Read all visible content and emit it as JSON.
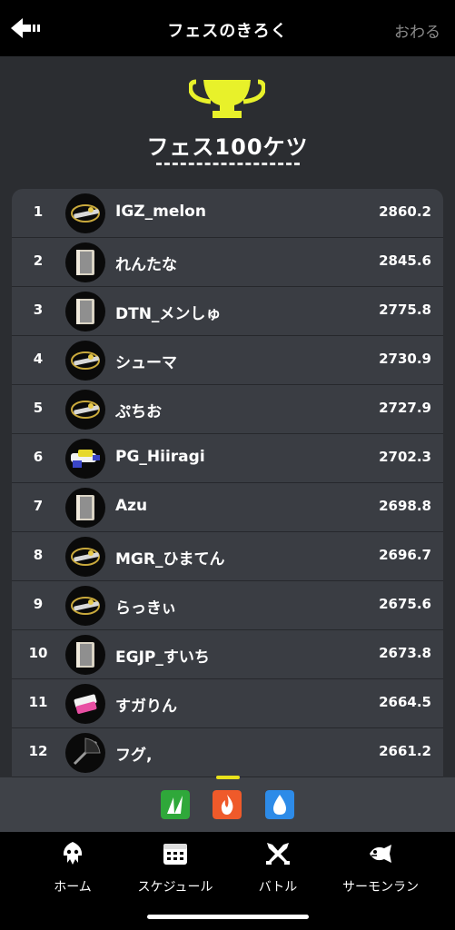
{
  "header": {
    "title": "フェスのきろく",
    "end_label": "おわる",
    "back_icon": "arrow-left-icon"
  },
  "section": {
    "title": "フェス100ケツ",
    "trophy_icon": "trophy-icon",
    "trophy_color": "#e8f12a"
  },
  "ranking": [
    {
      "rank": "1",
      "name": "IGZ_melon",
      "power": "2860.2",
      "weapon": "charger"
    },
    {
      "rank": "2",
      "name": "れんたな",
      "power": "2845.6",
      "weapon": "brush"
    },
    {
      "rank": "3",
      "name": "DTN_メンしゅ",
      "power": "2775.8",
      "weapon": "brush"
    },
    {
      "rank": "4",
      "name": "シューマ",
      "power": "2730.9",
      "weapon": "charger"
    },
    {
      "rank": "5",
      "name": "ぷちお",
      "power": "2727.9",
      "weapon": "charger"
    },
    {
      "rank": "6",
      "name": "PG_Hiiragi",
      "power": "2702.3",
      "weapon": "shooter"
    },
    {
      "rank": "7",
      "name": "Azu",
      "power": "2698.8",
      "weapon": "brush"
    },
    {
      "rank": "8",
      "name": "MGR_ひまてん",
      "power": "2696.7",
      "weapon": "charger"
    },
    {
      "rank": "9",
      "name": "らっきぃ",
      "power": "2675.6",
      "weapon": "charger"
    },
    {
      "rank": "10",
      "name": "EGJP_すいち",
      "power": "2673.8",
      "weapon": "brush"
    },
    {
      "rank": "11",
      "name": "すガりん",
      "power": "2664.5",
      "weapon": "dualie"
    },
    {
      "rank": "12",
      "name": "フグ,",
      "power": "2661.2",
      "weapon": "brella"
    }
  ],
  "teams": [
    {
      "name": "grass-team-icon",
      "color": "#2fa83a",
      "selected": true
    },
    {
      "name": "fire-team-icon",
      "color": "#ef5a2a",
      "selected": false
    },
    {
      "name": "water-team-icon",
      "color": "#2d8be8",
      "selected": false
    }
  ],
  "tabs": [
    {
      "label": "ホーム",
      "icon": "squid-icon"
    },
    {
      "label": "スケジュール",
      "icon": "calendar-icon"
    },
    {
      "label": "バトル",
      "icon": "crossed-weapons-icon"
    },
    {
      "label": "サーモンラン",
      "icon": "salmon-icon"
    }
  ],
  "colors": {
    "background": "#2b2d31",
    "list_bg": "#3a3d43",
    "accent_yellow": "#e9e21c"
  }
}
